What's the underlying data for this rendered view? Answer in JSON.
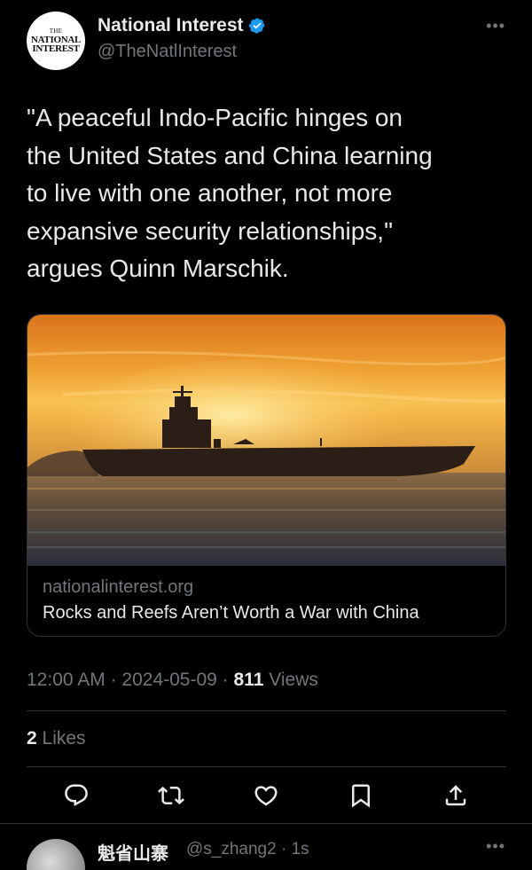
{
  "author": {
    "display_name": "National Interest",
    "handle": "@TheNatlInterest",
    "avatar_text": {
      "line1": "THE",
      "line2": "NATIONAL",
      "line3": "INTEREST"
    },
    "verified_color": "#1d9bf0"
  },
  "tweet": {
    "text": "\"A peaceful Indo-Pacific hinges on\nthe United States and China learning\nto live with one another, not more\nexpansive security relationships,\"\nargues Quinn Marschik."
  },
  "card": {
    "domain": "nationalinterest.org",
    "title": "Rocks and Reefs Aren’t Worth a War with China",
    "image_icon": "aircraft-carrier-sunset-photo"
  },
  "meta": {
    "time": "12:00 AM",
    "date": "2024-05-09",
    "separator": " · ",
    "views_count": "811",
    "views_label": " Views"
  },
  "likes": {
    "count": "2",
    "label": " Likes"
  },
  "actions": [
    {
      "icon": "reply-icon"
    },
    {
      "icon": "retweet-icon"
    },
    {
      "icon": "like-icon"
    },
    {
      "icon": "bookmark-icon"
    },
    {
      "icon": "share-icon"
    }
  ],
  "reply": {
    "display_name": "魁省山寨",
    "handle_time": "@s_zhang2 · 1s"
  },
  "colors": {
    "background": "#000000",
    "text_primary": "#e7e9ea",
    "text_secondary": "#71767b",
    "border": "#2f3336",
    "accent": "#1d9bf0"
  }
}
